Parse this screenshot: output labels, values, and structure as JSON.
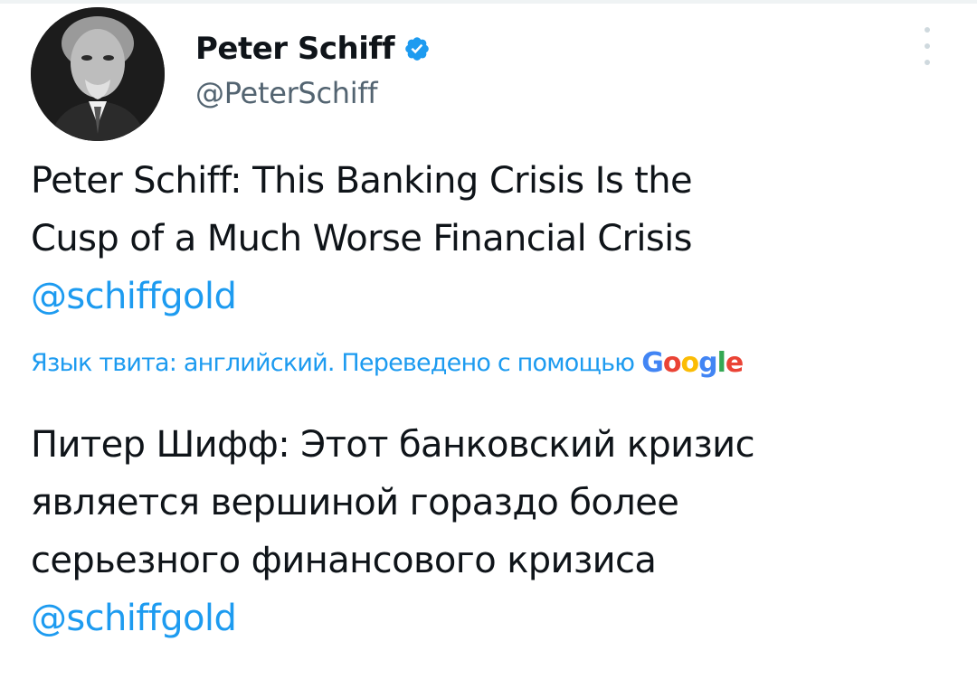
{
  "author": {
    "display_name": "Peter Schiff",
    "handle": "@PeterSchiff",
    "verified": true,
    "verified_color": "#1d9bf0",
    "avatar_icon": "portrait-photo"
  },
  "tweet": {
    "lines": [
      "Peter Schiff: This Banking Crisis Is the",
      "Cusp of a Much Worse Financial Crisis"
    ],
    "mention": "@schiffgold"
  },
  "translation": {
    "label": "Язык твита: английский. Переведено с помощью",
    "provider": "Google",
    "lines": [
      "Питер Шифф: Этот банковский кризис",
      "является вершиной гораздо более",
      "серьезного финансового кризиса"
    ],
    "mention": "@schiffgold"
  },
  "colors": {
    "link": "#1d9bf0",
    "text": "#0f1419",
    "secondary": "#536471"
  }
}
